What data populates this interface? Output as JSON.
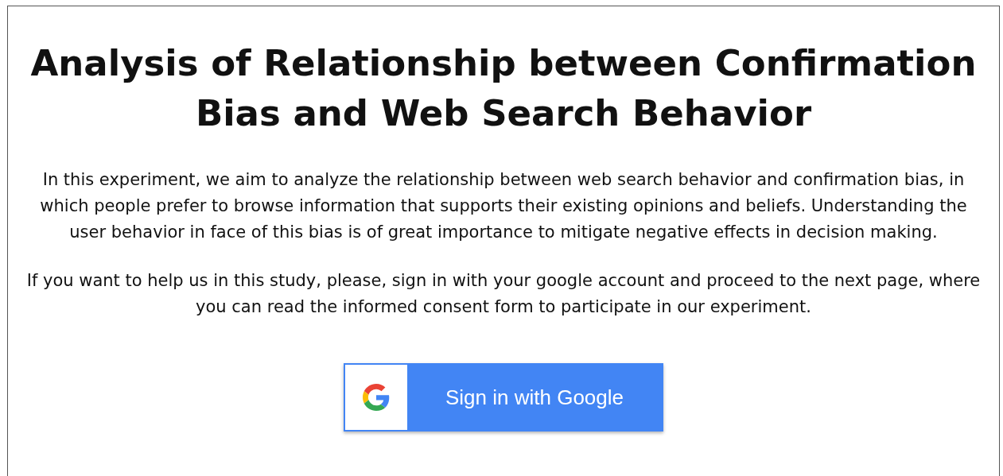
{
  "title": "Analysis of Relationship between Confirmation Bias and Web Search Behavior",
  "paragraphs": [
    "In this experiment, we aim to analyze the relationship between web search behavior and confirmation bias, in which people prefer to browse information that supports their existing opinions and beliefs. Understanding the user behavior in face of this bias is of great importance to mitigate negative effects in decision making.",
    "If you want to help us in this study, please, sign in with your google account and proceed to the next page, where you can read the informed consent form to participate in our experiment."
  ],
  "sign_in_button": {
    "label": "Sign in with Google"
  }
}
